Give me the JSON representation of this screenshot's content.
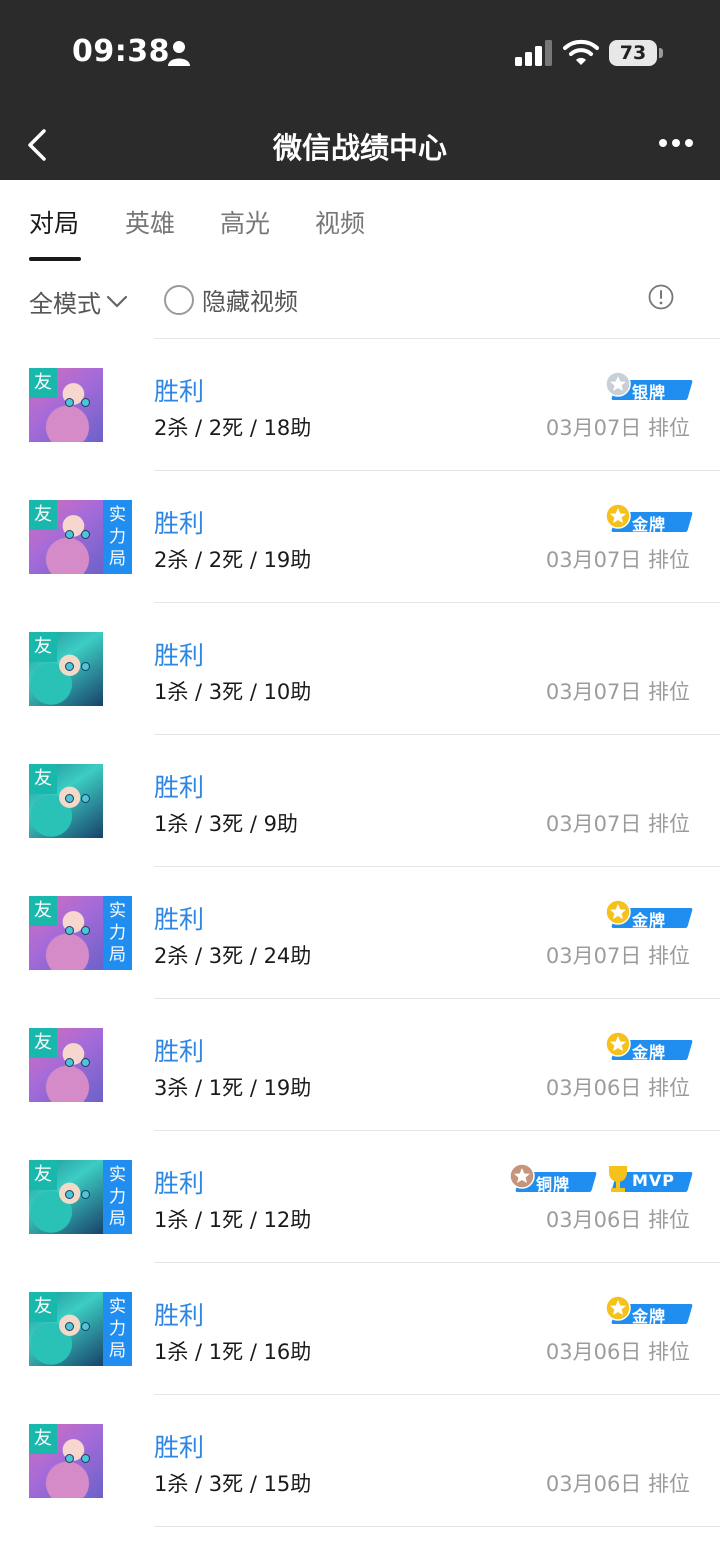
{
  "status_bar": {
    "time": "09:38",
    "battery": "73"
  },
  "nav": {
    "title": "微信战绩中心"
  },
  "tabs": [
    {
      "label": "对局",
      "active": true
    },
    {
      "label": "英雄",
      "active": false
    },
    {
      "label": "高光",
      "active": false
    },
    {
      "label": "视频",
      "active": false
    }
  ],
  "filters": {
    "mode": "全模式",
    "hide_video": "隐藏视频"
  },
  "tags": {
    "friend": "友",
    "power_line1": "实",
    "power_line2": "力",
    "power_line3": "局"
  },
  "matches": [
    {
      "result": "胜利",
      "kda": "2杀 / 2死 / 18助",
      "date": "03月07日",
      "mode": "排位",
      "hero": "pink",
      "power": false,
      "badges": [
        {
          "label": "银牌",
          "kind": "silver"
        }
      ]
    },
    {
      "result": "胜利",
      "kda": "2杀 / 2死 / 19助",
      "date": "03月07日",
      "mode": "排位",
      "hero": "pink",
      "power": true,
      "badges": [
        {
          "label": "金牌",
          "kind": "gold"
        }
      ]
    },
    {
      "result": "胜利",
      "kda": "1杀 / 3死 / 10助",
      "date": "03月07日",
      "mode": "排位",
      "hero": "teal",
      "power": false,
      "badges": []
    },
    {
      "result": "胜利",
      "kda": "1杀 / 3死 / 9助",
      "date": "03月07日",
      "mode": "排位",
      "hero": "teal",
      "power": false,
      "badges": []
    },
    {
      "result": "胜利",
      "kda": "2杀 / 3死 / 24助",
      "date": "03月07日",
      "mode": "排位",
      "hero": "pink",
      "power": true,
      "badges": [
        {
          "label": "金牌",
          "kind": "gold"
        }
      ]
    },
    {
      "result": "胜利",
      "kda": "3杀 / 1死 / 19助",
      "date": "03月06日",
      "mode": "排位",
      "hero": "pink",
      "power": false,
      "badges": [
        {
          "label": "金牌",
          "kind": "gold"
        }
      ]
    },
    {
      "result": "胜利",
      "kda": "1杀 / 1死 / 12助",
      "date": "03月06日",
      "mode": "排位",
      "hero": "teal",
      "power": true,
      "badges": [
        {
          "label": "铜牌",
          "kind": "bronze"
        },
        {
          "label": "MVP",
          "kind": "mvp"
        }
      ]
    },
    {
      "result": "胜利",
      "kda": "1杀 / 1死 / 16助",
      "date": "03月06日",
      "mode": "排位",
      "hero": "teal",
      "power": true,
      "badges": [
        {
          "label": "金牌",
          "kind": "gold"
        }
      ]
    },
    {
      "result": "胜利",
      "kda": "1杀 / 3死 / 15助",
      "date": "03月06日",
      "mode": "排位",
      "hero": "pink",
      "power": false,
      "badges": []
    }
  ],
  "colors": {
    "accent_blue": "#2b86e4",
    "badge_blue": "#1f8ef0",
    "friend_teal": "#19b8ad",
    "header_dark": "#2b2b2b"
  }
}
